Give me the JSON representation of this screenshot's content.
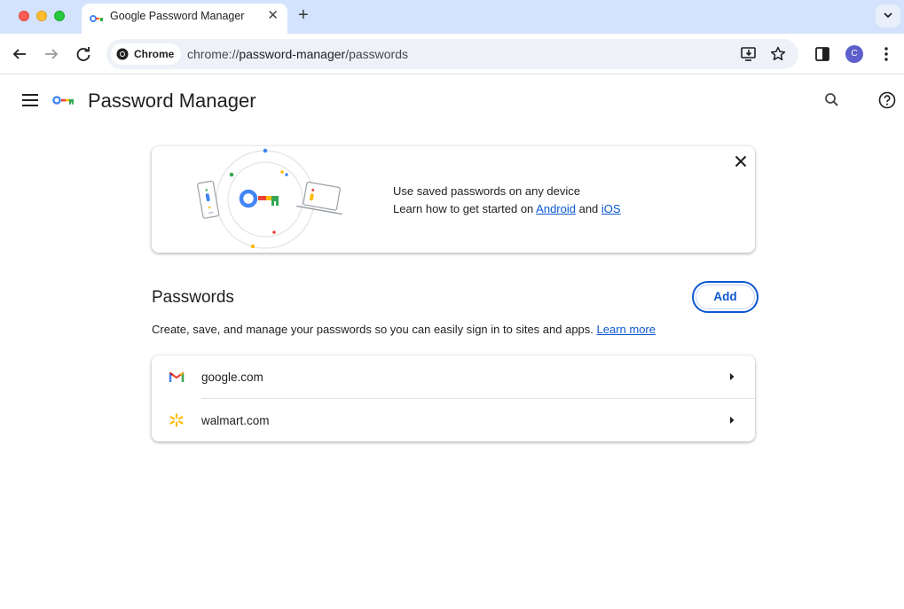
{
  "browser": {
    "tab_title": "Google Password Manager",
    "new_tab_symbol": "+",
    "tab_close_symbol": "✕",
    "omnibox_chip_label": "Chrome",
    "url_scheme": "chrome://",
    "url_host": "password-manager",
    "url_path": "/passwords",
    "profile_initial": "C"
  },
  "header": {
    "title": "Password Manager"
  },
  "promo": {
    "line1": "Use saved passwords on any device",
    "line2_prefix": "Learn how to get started on ",
    "android_link": "Android",
    "line2_middle": " and ",
    "ios_link": "iOS"
  },
  "passwords": {
    "title": "Passwords",
    "add_label": "Add",
    "description": "Create, save, and manage your passwords so you can easily sign in to sites and apps. ",
    "learn_more": "Learn more",
    "items": [
      {
        "site": "google.com",
        "icon": "gmail-icon"
      },
      {
        "site": "walmart.com",
        "icon": "walmart-spark-icon"
      }
    ]
  },
  "colors": {
    "accent": "#0b57d0",
    "tabstrip": "#d3e3fd",
    "omnibox": "#eef1f8",
    "avatar": "#5d5fcb"
  }
}
